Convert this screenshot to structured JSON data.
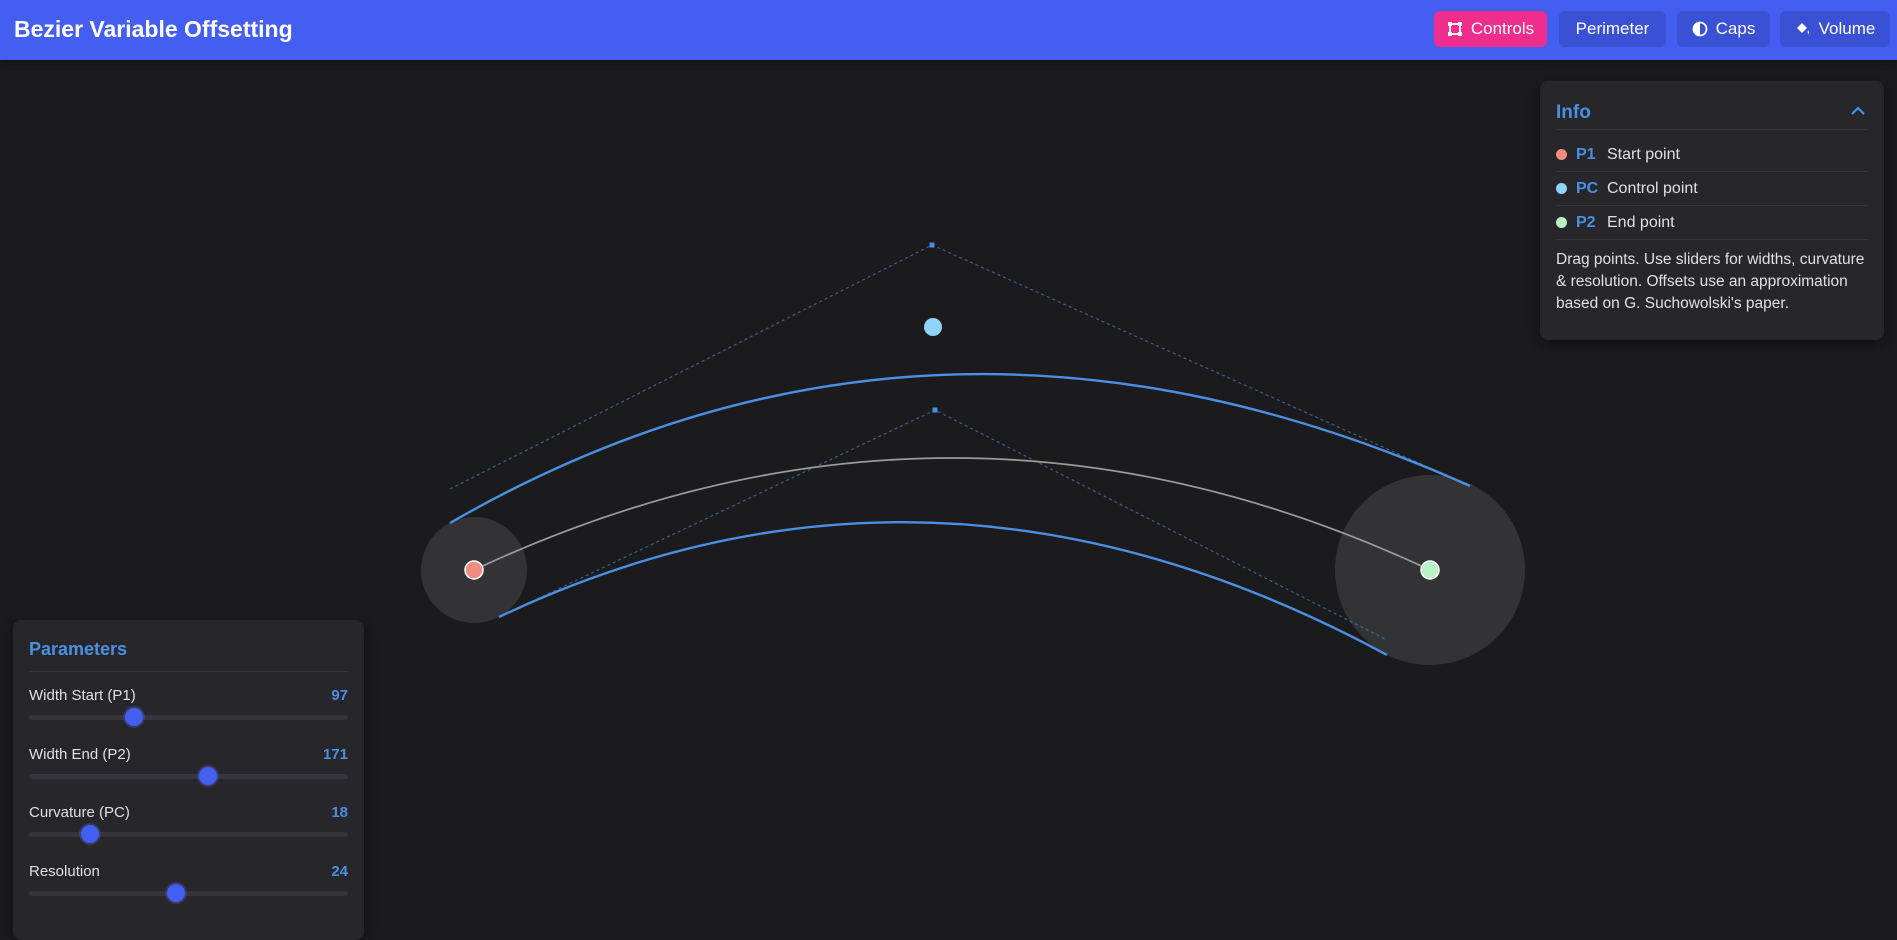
{
  "app": {
    "title": "Bezier Variable Offsetting"
  },
  "toolbar": {
    "buttons": [
      {
        "label": "Controls",
        "icon": "bezier-controls-icon",
        "active": true
      },
      {
        "label": "Perimeter",
        "icon": "",
        "active": false
      },
      {
        "label": "Caps",
        "icon": "half-circle-icon",
        "active": false
      },
      {
        "label": "Volume",
        "icon": "paint-bucket-icon",
        "active": false
      }
    ]
  },
  "info": {
    "title": "Info",
    "legend": [
      {
        "key": "P1",
        "label": "Start point",
        "color": "#f28b82"
      },
      {
        "key": "PC",
        "label": "Control point",
        "color": "#8fd4f8"
      },
      {
        "key": "P2",
        "label": "End point",
        "color": "#b9f2c6"
      }
    ],
    "description": "Drag points. Use sliders for widths, curvature & resolution. Offsets use an approximation based on G. Suchowolski's paper."
  },
  "parameters": {
    "title": "Parameters",
    "sliders": [
      {
        "label": "Width Start (P1)",
        "value": 97,
        "fraction": 0.33
      },
      {
        "label": "Width End (P2)",
        "value": 171,
        "fraction": 0.56
      },
      {
        "label": "Curvature (PC)",
        "value": 18,
        "fraction": 0.19
      },
      {
        "label": "Resolution",
        "value": 24,
        "fraction": 0.46
      }
    ]
  },
  "colors": {
    "topbar": "#435ef0",
    "active_button": "#ee2d8c",
    "offset_curve": "#4a90e2",
    "center_curve": "#9a9a9a",
    "accent_text": "#4a90e2"
  }
}
